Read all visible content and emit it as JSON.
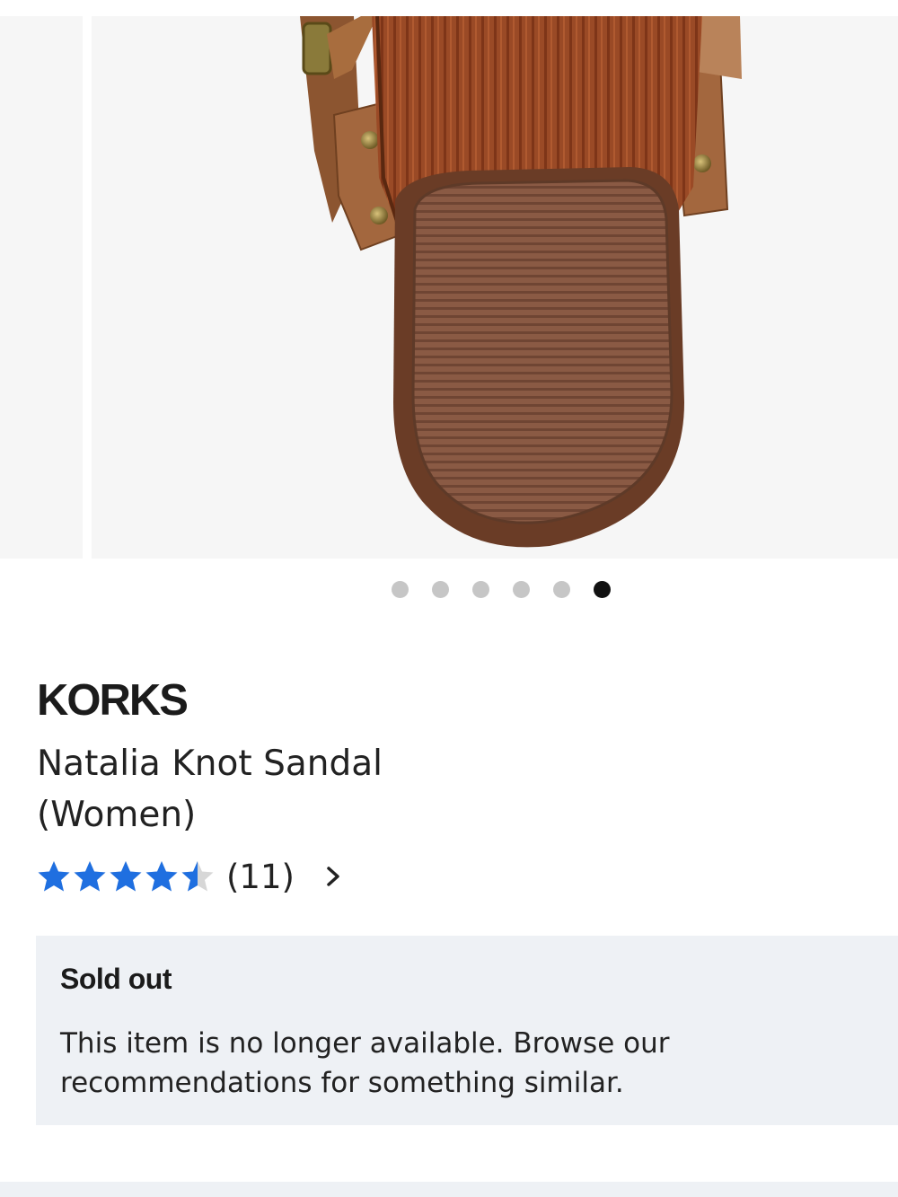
{
  "product": {
    "brand": "KORKS",
    "name": "Natalia Knot Sandal (Women)",
    "rating": 4.5,
    "review_count": "(11)",
    "image_alt": "Natalia Knot Sandal heel sole view"
  },
  "carousel": {
    "slide_count": 6,
    "active_index": 5
  },
  "availability": {
    "title": "Sold out",
    "message": "This item is no longer available. Browse our recommendations for something similar."
  },
  "icons": {
    "star": "star-icon",
    "chevron": "chevron-right-icon"
  },
  "colors": {
    "star": "#1f6fe0",
    "star_empty": "#d7d7d7",
    "banner_bg": "#eef1f5",
    "active_dot": "#111111",
    "inactive_dot": "#c6c6c6"
  }
}
